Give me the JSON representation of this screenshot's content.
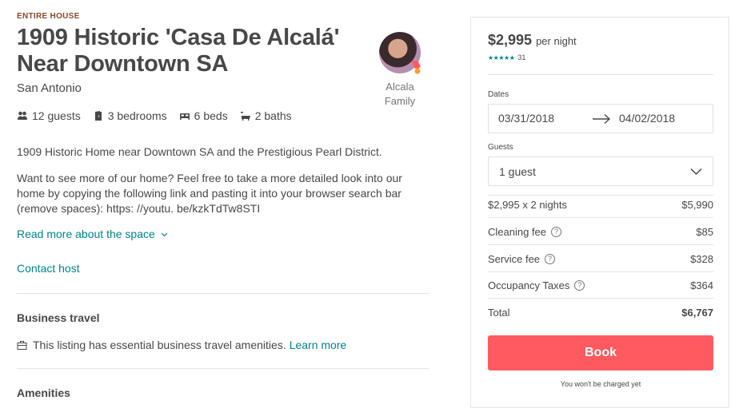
{
  "listing": {
    "kicker": "ENTIRE HOUSE",
    "title": "1909 Historic 'Casa De Alcalá' Near Downtown SA",
    "city": "San Antonio",
    "host_name": "Alcala Family",
    "features": {
      "guests": "12 guests",
      "bedrooms": "3 bedrooms",
      "beds": "6 beds",
      "baths": "2 baths"
    },
    "description": [
      "1909 Historic Home near Downtown SA and the Prestigious Pearl District.",
      "Want to see more of our home? Feel free to take a more detailed look into our home by copying the following link and pasting it into your browser search bar (remove spaces): https: //youtu. be/kzkTdTw8STI"
    ],
    "read_more": "Read more about the space",
    "contact_host": "Contact host",
    "business_travel": {
      "title": "Business travel",
      "text": "This listing has essential business travel amenities.",
      "link": "Learn more"
    },
    "amenities_title": "Amenities"
  },
  "booking": {
    "price": "$2,995",
    "per_night": "per night",
    "stars": "★★★★★",
    "review_count": "31",
    "dates_label": "Dates",
    "checkin": "03/31/2018",
    "checkout": "04/02/2018",
    "guests_label": "Guests",
    "guests_value": "1 guest",
    "lines": [
      {
        "name": "$2,995 x 2 nights",
        "value": "$5,990"
      },
      {
        "name": "Cleaning fee",
        "value": "$85"
      },
      {
        "name": "Service fee",
        "value": "$328"
      },
      {
        "name": "Occupancy Taxes",
        "value": "$364"
      }
    ],
    "total_label": "Total",
    "total_value": "$6,767",
    "book_label": "Book",
    "note": "You won't be charged yet"
  },
  "colors": {
    "accent": "#008489",
    "book_button": "#ff5a5f",
    "text": "#484848"
  }
}
